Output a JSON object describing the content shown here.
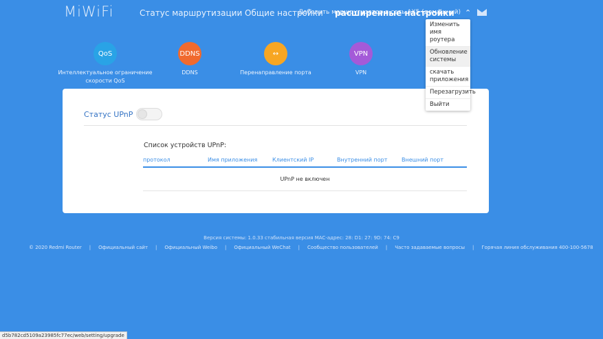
{
  "header": {
    "logo": "MiWiFi",
    "nav": [
      "Статус маршрутизации",
      "Общие настройки",
      "расширенные настройки"
    ],
    "user_info": "Добавить маршрутизатор в сеть AX5 (домашний)",
    "chevron": "^"
  },
  "dropdown": {
    "items": [
      "Изменить имя роутера",
      "Обновление системы",
      "скачать приложения",
      "Перезагрузить",
      "Выйти"
    ]
  },
  "apps": [
    {
      "icon_text": "QoS",
      "label": "Интеллектуальное ограничение скорости QoS",
      "color": "#29a3e6"
    },
    {
      "icon_text": "DDNS",
      "label": "DDNS",
      "color": "#f06a2e"
    },
    {
      "icon_text": "↔",
      "label": "Перенаправление порта",
      "color": "#f7a623"
    },
    {
      "icon_text": "VPN",
      "label": "VPN",
      "color": "#a45ad8"
    }
  ],
  "upnp": {
    "status_label": "Статус UPnP",
    "list_title": "Список устройств UPnP:",
    "columns": [
      "протокол",
      "Имя приложения",
      "Клиентский IP",
      "Внутренний порт",
      "Внешний порт"
    ],
    "empty_message": "UPnP не включен"
  },
  "footer": {
    "version": "Версия системы: 1.0.33 стабильная версия MAC-адрес: 28: D1: 27: 9D: 74: C9",
    "links": [
      "© 2020 Redmi Router",
      "Официальный сайт",
      "Официальный Weibo",
      "Официальный WeChat",
      "Сообщество пользователей",
      "Часто задаваемые вопросы",
      "Горячая линия обслуживания 400-100-5678"
    ]
  },
  "status_url": "d5b782cd5109a23985fc77ec/web/setting/upgrade"
}
